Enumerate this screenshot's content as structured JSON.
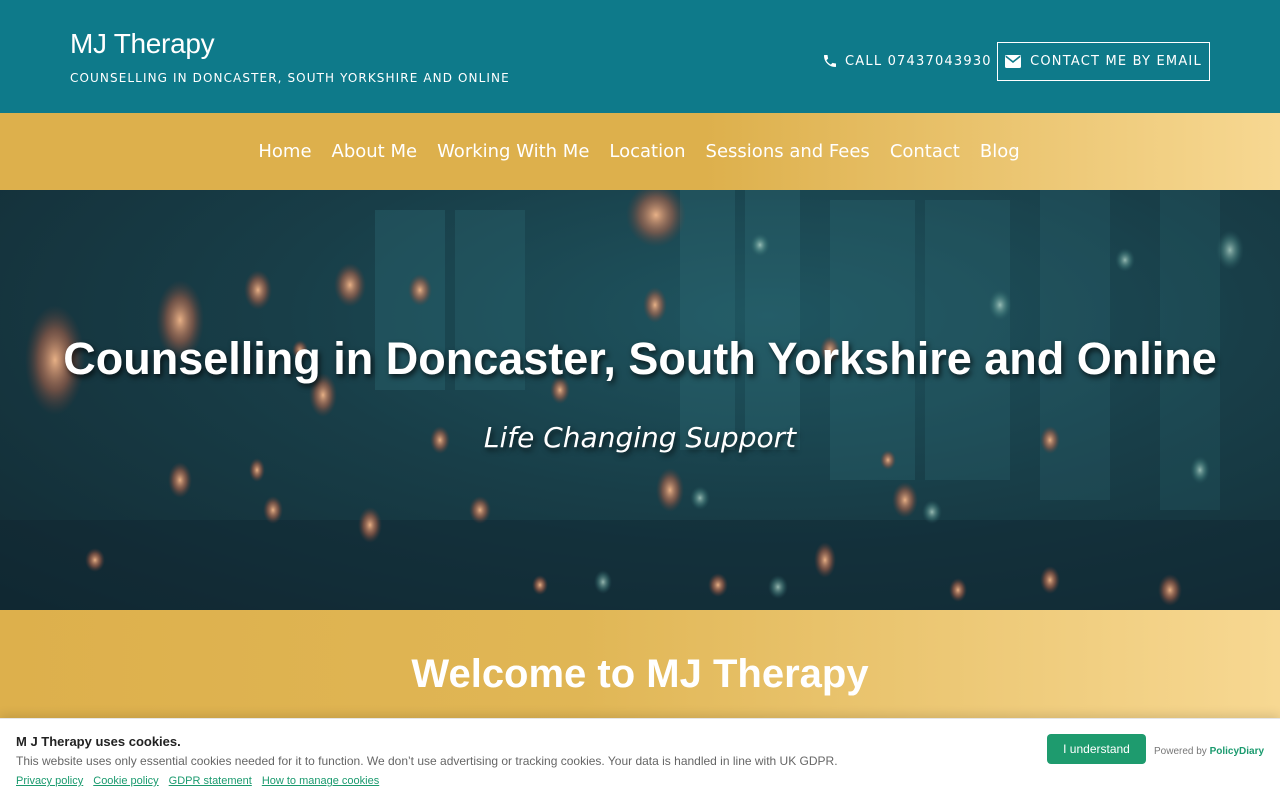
{
  "header": {
    "brand_title": "MJ Therapy",
    "brand_subtitle": "COUNSELLING IN DONCASTER, SOUTH YORKSHIRE AND ONLINE",
    "call_label": "CALL 07437043930",
    "email_label": "CONTACT ME BY EMAIL",
    "icons": [
      "phone-icon",
      "envelope-icon"
    ],
    "background_color": "#0e7a8a"
  },
  "nav": {
    "items": [
      {
        "label": "Home"
      },
      {
        "label": "About Me"
      },
      {
        "label": "Working With Me"
      },
      {
        "label": "Location"
      },
      {
        "label": "Sessions and Fees"
      },
      {
        "label": "Contact"
      },
      {
        "label": "Blog"
      }
    ],
    "gradient_start": "#ddb04c",
    "gradient_end": "#f7d892"
  },
  "hero": {
    "title": "Counselling in Doncaster, South Yorkshire and Online",
    "tagline": "Life Changing Support"
  },
  "welcome": {
    "title": "Welcome to MJ Therapy"
  },
  "cookie_banner": {
    "title": "M J Therapy uses cookies.",
    "text": "This website uses only essential cookies needed for it to function. We don’t use advertising or tracking cookies. Your data is handled in line with UK GDPR.",
    "links": [
      "Privacy policy",
      "Cookie policy",
      "GDPR statement",
      "How to manage cookies"
    ],
    "accept_label": "I understand",
    "powered_prefix": "Powered by",
    "powered_brand": "PolicyDiary",
    "accent_color": "#1e9b6e"
  }
}
